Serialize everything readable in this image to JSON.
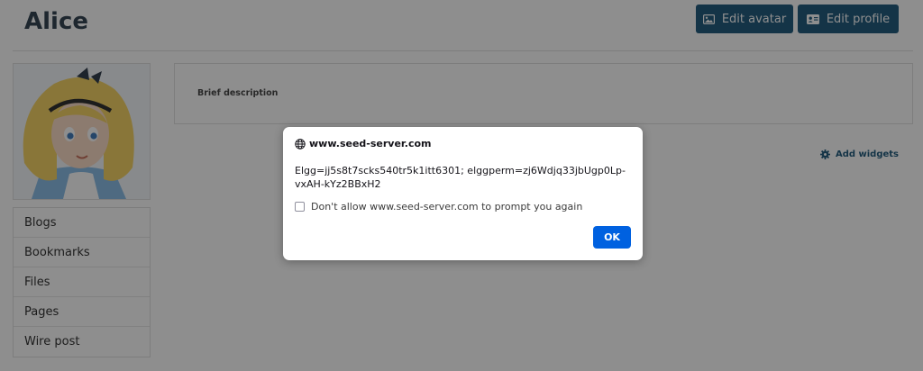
{
  "profile": {
    "name": "Alice"
  },
  "actions": {
    "edit_avatar": "Edit avatar",
    "edit_profile": "Edit profile"
  },
  "owner_menu": {
    "items": [
      {
        "label": "Blogs"
      },
      {
        "label": "Bookmarks"
      },
      {
        "label": "Files"
      },
      {
        "label": "Pages"
      },
      {
        "label": "Wire post"
      }
    ]
  },
  "details": {
    "brief_description_label": "Brief description"
  },
  "widgets": {
    "add_label": "Add widgets"
  },
  "dialog": {
    "origin": "www.seed-server.com",
    "message": "Elgg=jj5s8t7scks540tr5k1itt6301; elggperm=zj6Wdjq33jbUgp0Lp-vxAH-kYz2BBxH2",
    "checkbox_label": "Don't allow www.seed-server.com to prompt you again",
    "ok_label": "OK"
  },
  "colors": {
    "brand": "#0a4b70",
    "dialog_button": "#0061e0"
  },
  "icons": {
    "edit_avatar": "image-icon",
    "edit_profile": "id-card-icon",
    "add_widgets": "gear-icon",
    "dialog_origin": "globe-icon"
  }
}
